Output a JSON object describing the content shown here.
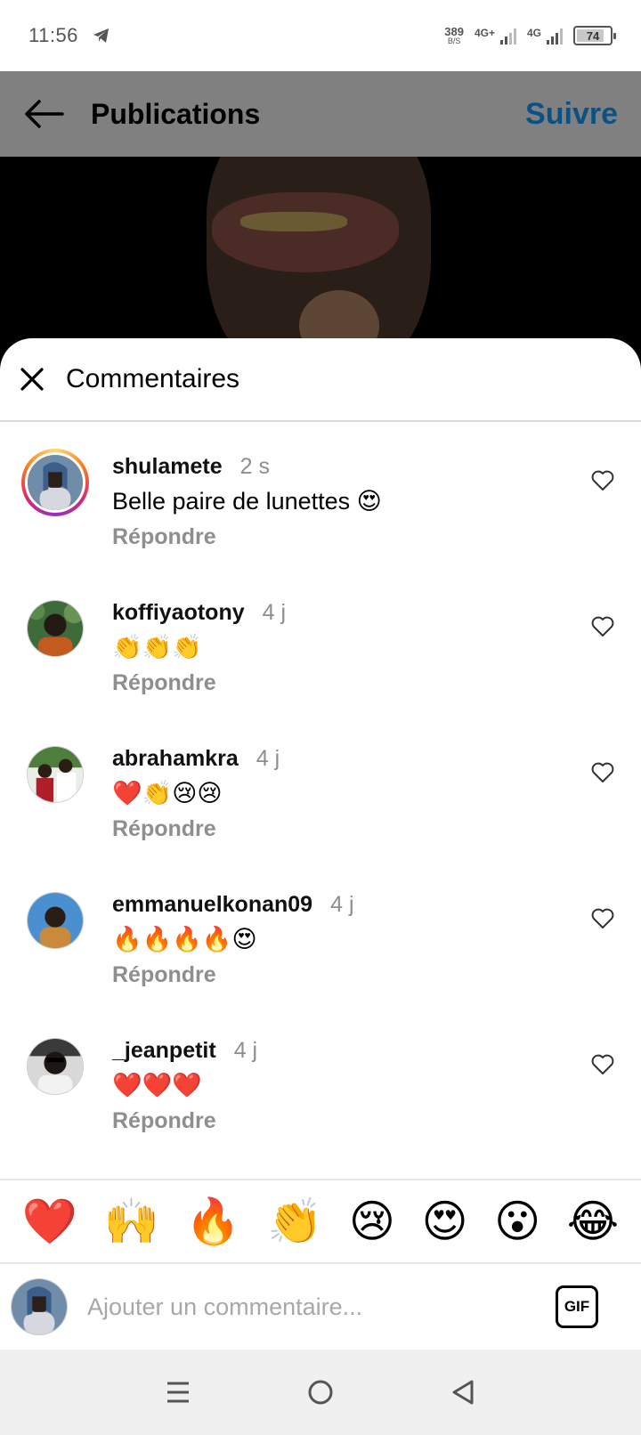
{
  "status_bar": {
    "time": "11:56",
    "net_speed_value": "389",
    "net_speed_unit": "B/S",
    "signal1_label": "4G+",
    "signal2_label": "4G",
    "battery": "74"
  },
  "header": {
    "title": "Publications",
    "follow_label": "Suivre"
  },
  "sheet": {
    "title": "Commentaires"
  },
  "comments": [
    {
      "username": "shulamete",
      "time": "2 s",
      "text": "Belle paire de lunettes 😍",
      "reply_label": "Répondre"
    },
    {
      "username": "koffiyaotony",
      "time": "4 j",
      "text": "👏👏👏",
      "reply_label": "Répondre"
    },
    {
      "username": "abrahamkra",
      "time": "4 j",
      "text": "❤️👏😢😢",
      "reply_label": "Répondre"
    },
    {
      "username": "emmanuelkonan09",
      "time": "4 j",
      "text": "🔥🔥🔥🔥😍",
      "reply_label": "Répondre"
    },
    {
      "username": "_jeanpetit",
      "time": "4 j",
      "text": "❤️❤️❤️",
      "reply_label": "Répondre"
    }
  ],
  "reactions": [
    "❤️",
    "🙌",
    "🔥",
    "👏",
    "😢",
    "😍",
    "😮",
    "😂"
  ],
  "compose": {
    "placeholder": "Ajouter un commentaire...",
    "gif_label": "GIF"
  }
}
